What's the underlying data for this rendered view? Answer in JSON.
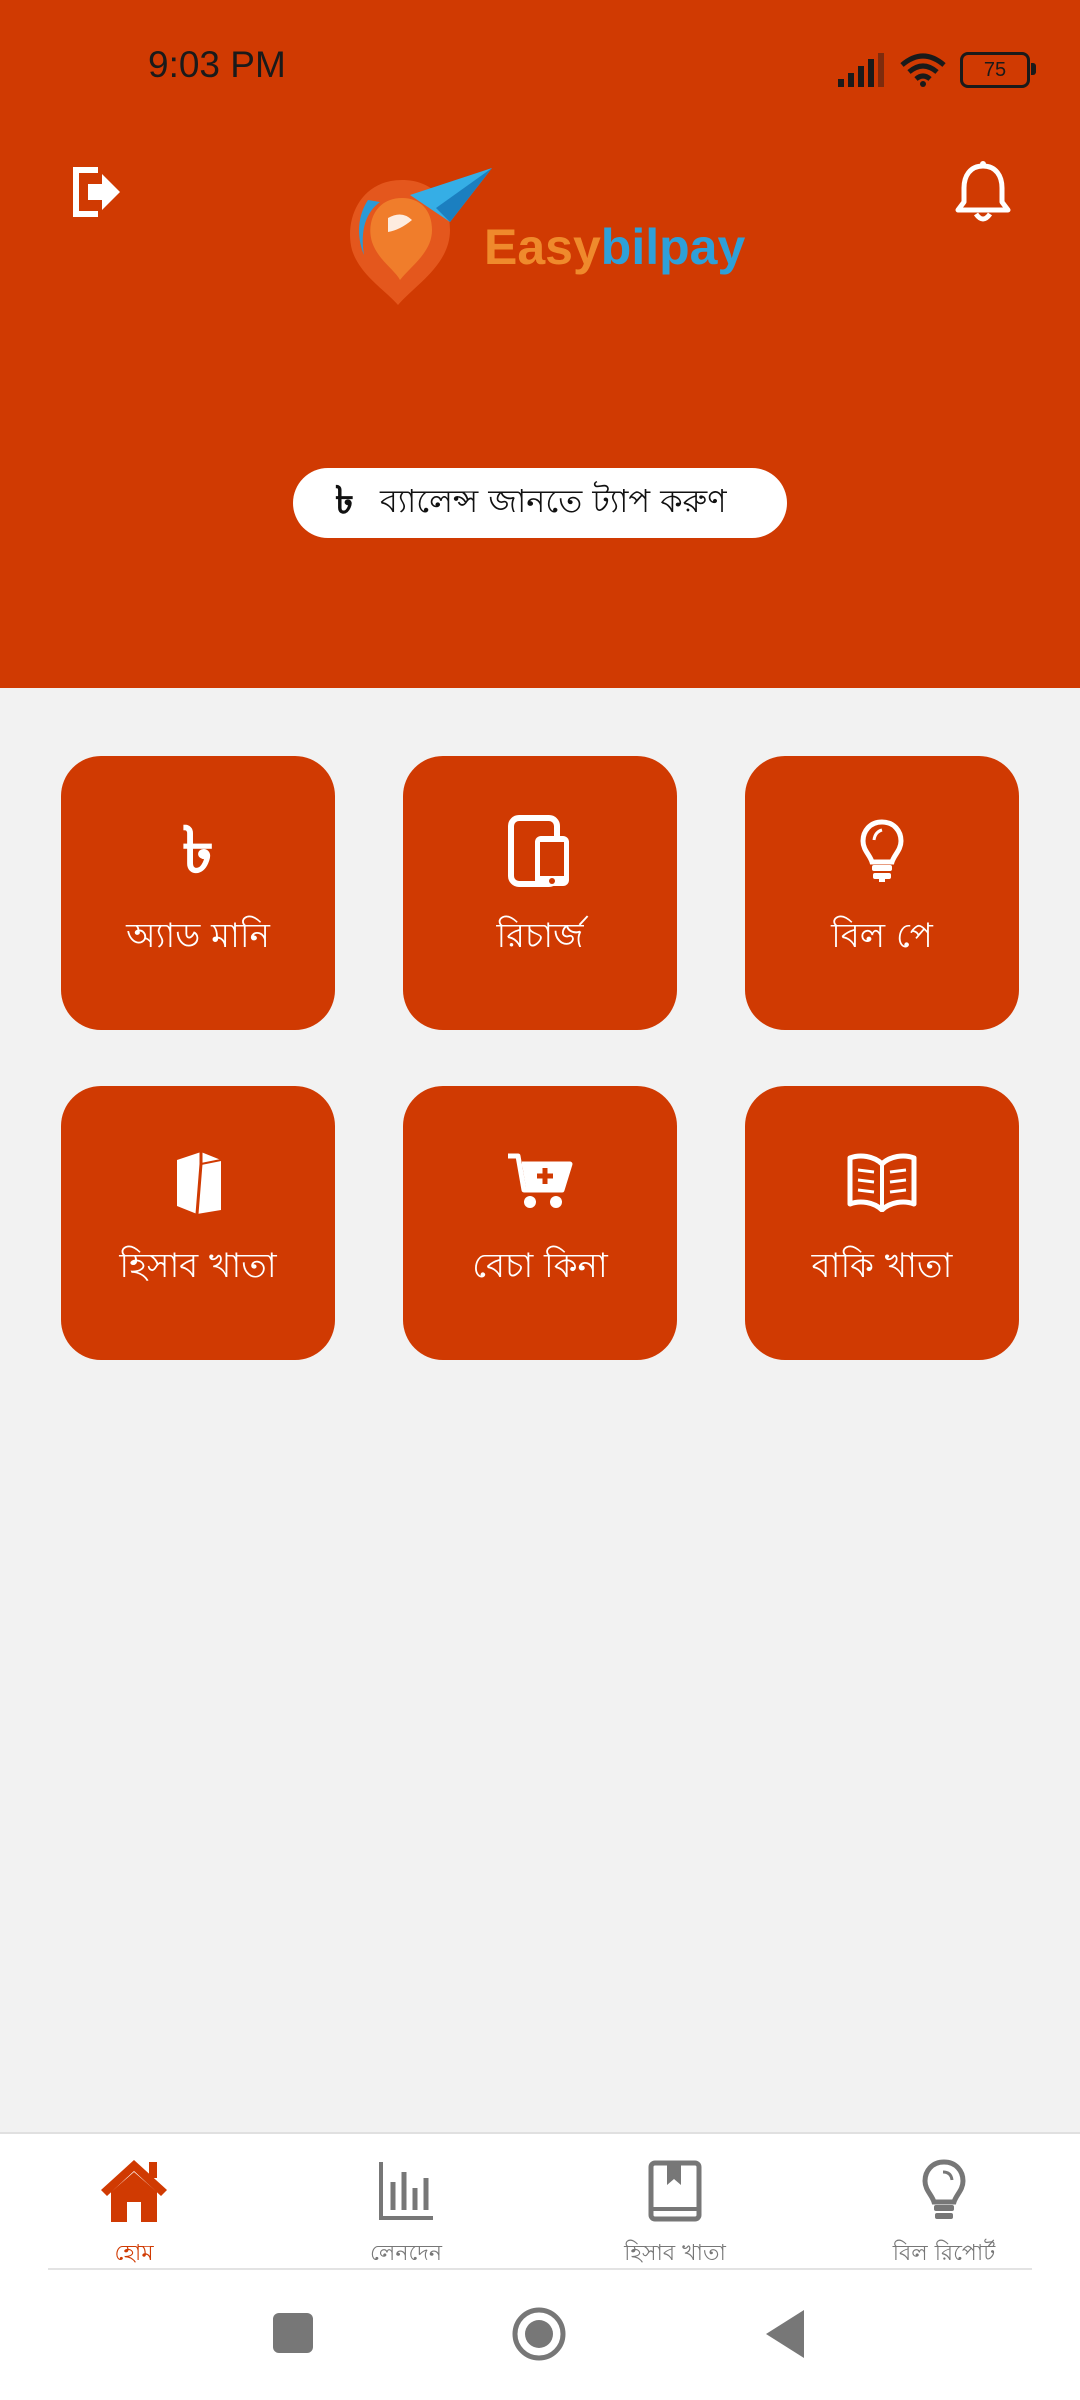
{
  "status": {
    "time": "9:03 PM",
    "battery": "75"
  },
  "header": {
    "logo_part1": "Easy",
    "logo_part2": "bilpay",
    "balance_currency": "৳",
    "balance_hint": "ব্যালেন্স জানতে ট্যাপ করুণ"
  },
  "tiles": [
    {
      "label": "অ্যাড মানি",
      "icon": "taka-icon",
      "symbol": "৳"
    },
    {
      "label": "রিচার্জ",
      "icon": "mobile-devices-icon"
    },
    {
      "label": "বিল পে",
      "icon": "lightbulb-icon"
    },
    {
      "label": "হিসাব খাতা",
      "icon": "book-icon"
    },
    {
      "label": "বেচা কিনা",
      "icon": "cart-plus-icon"
    },
    {
      "label": "বাকি খাতা",
      "icon": "open-book-icon"
    }
  ],
  "nav": [
    {
      "label": "হোম",
      "icon": "home-icon",
      "active": true
    },
    {
      "label": "লেনদেন",
      "icon": "bar-chart-icon",
      "active": false
    },
    {
      "label": "হিসাব খাতা",
      "icon": "bookmark-book-icon",
      "active": false
    },
    {
      "label": "বিল রিপোর্ট",
      "icon": "lightbulb-icon",
      "active": false
    }
  ],
  "colors": {
    "primary": "#d03a02",
    "background": "#f2f2f2",
    "nav_inactive": "#777777"
  }
}
